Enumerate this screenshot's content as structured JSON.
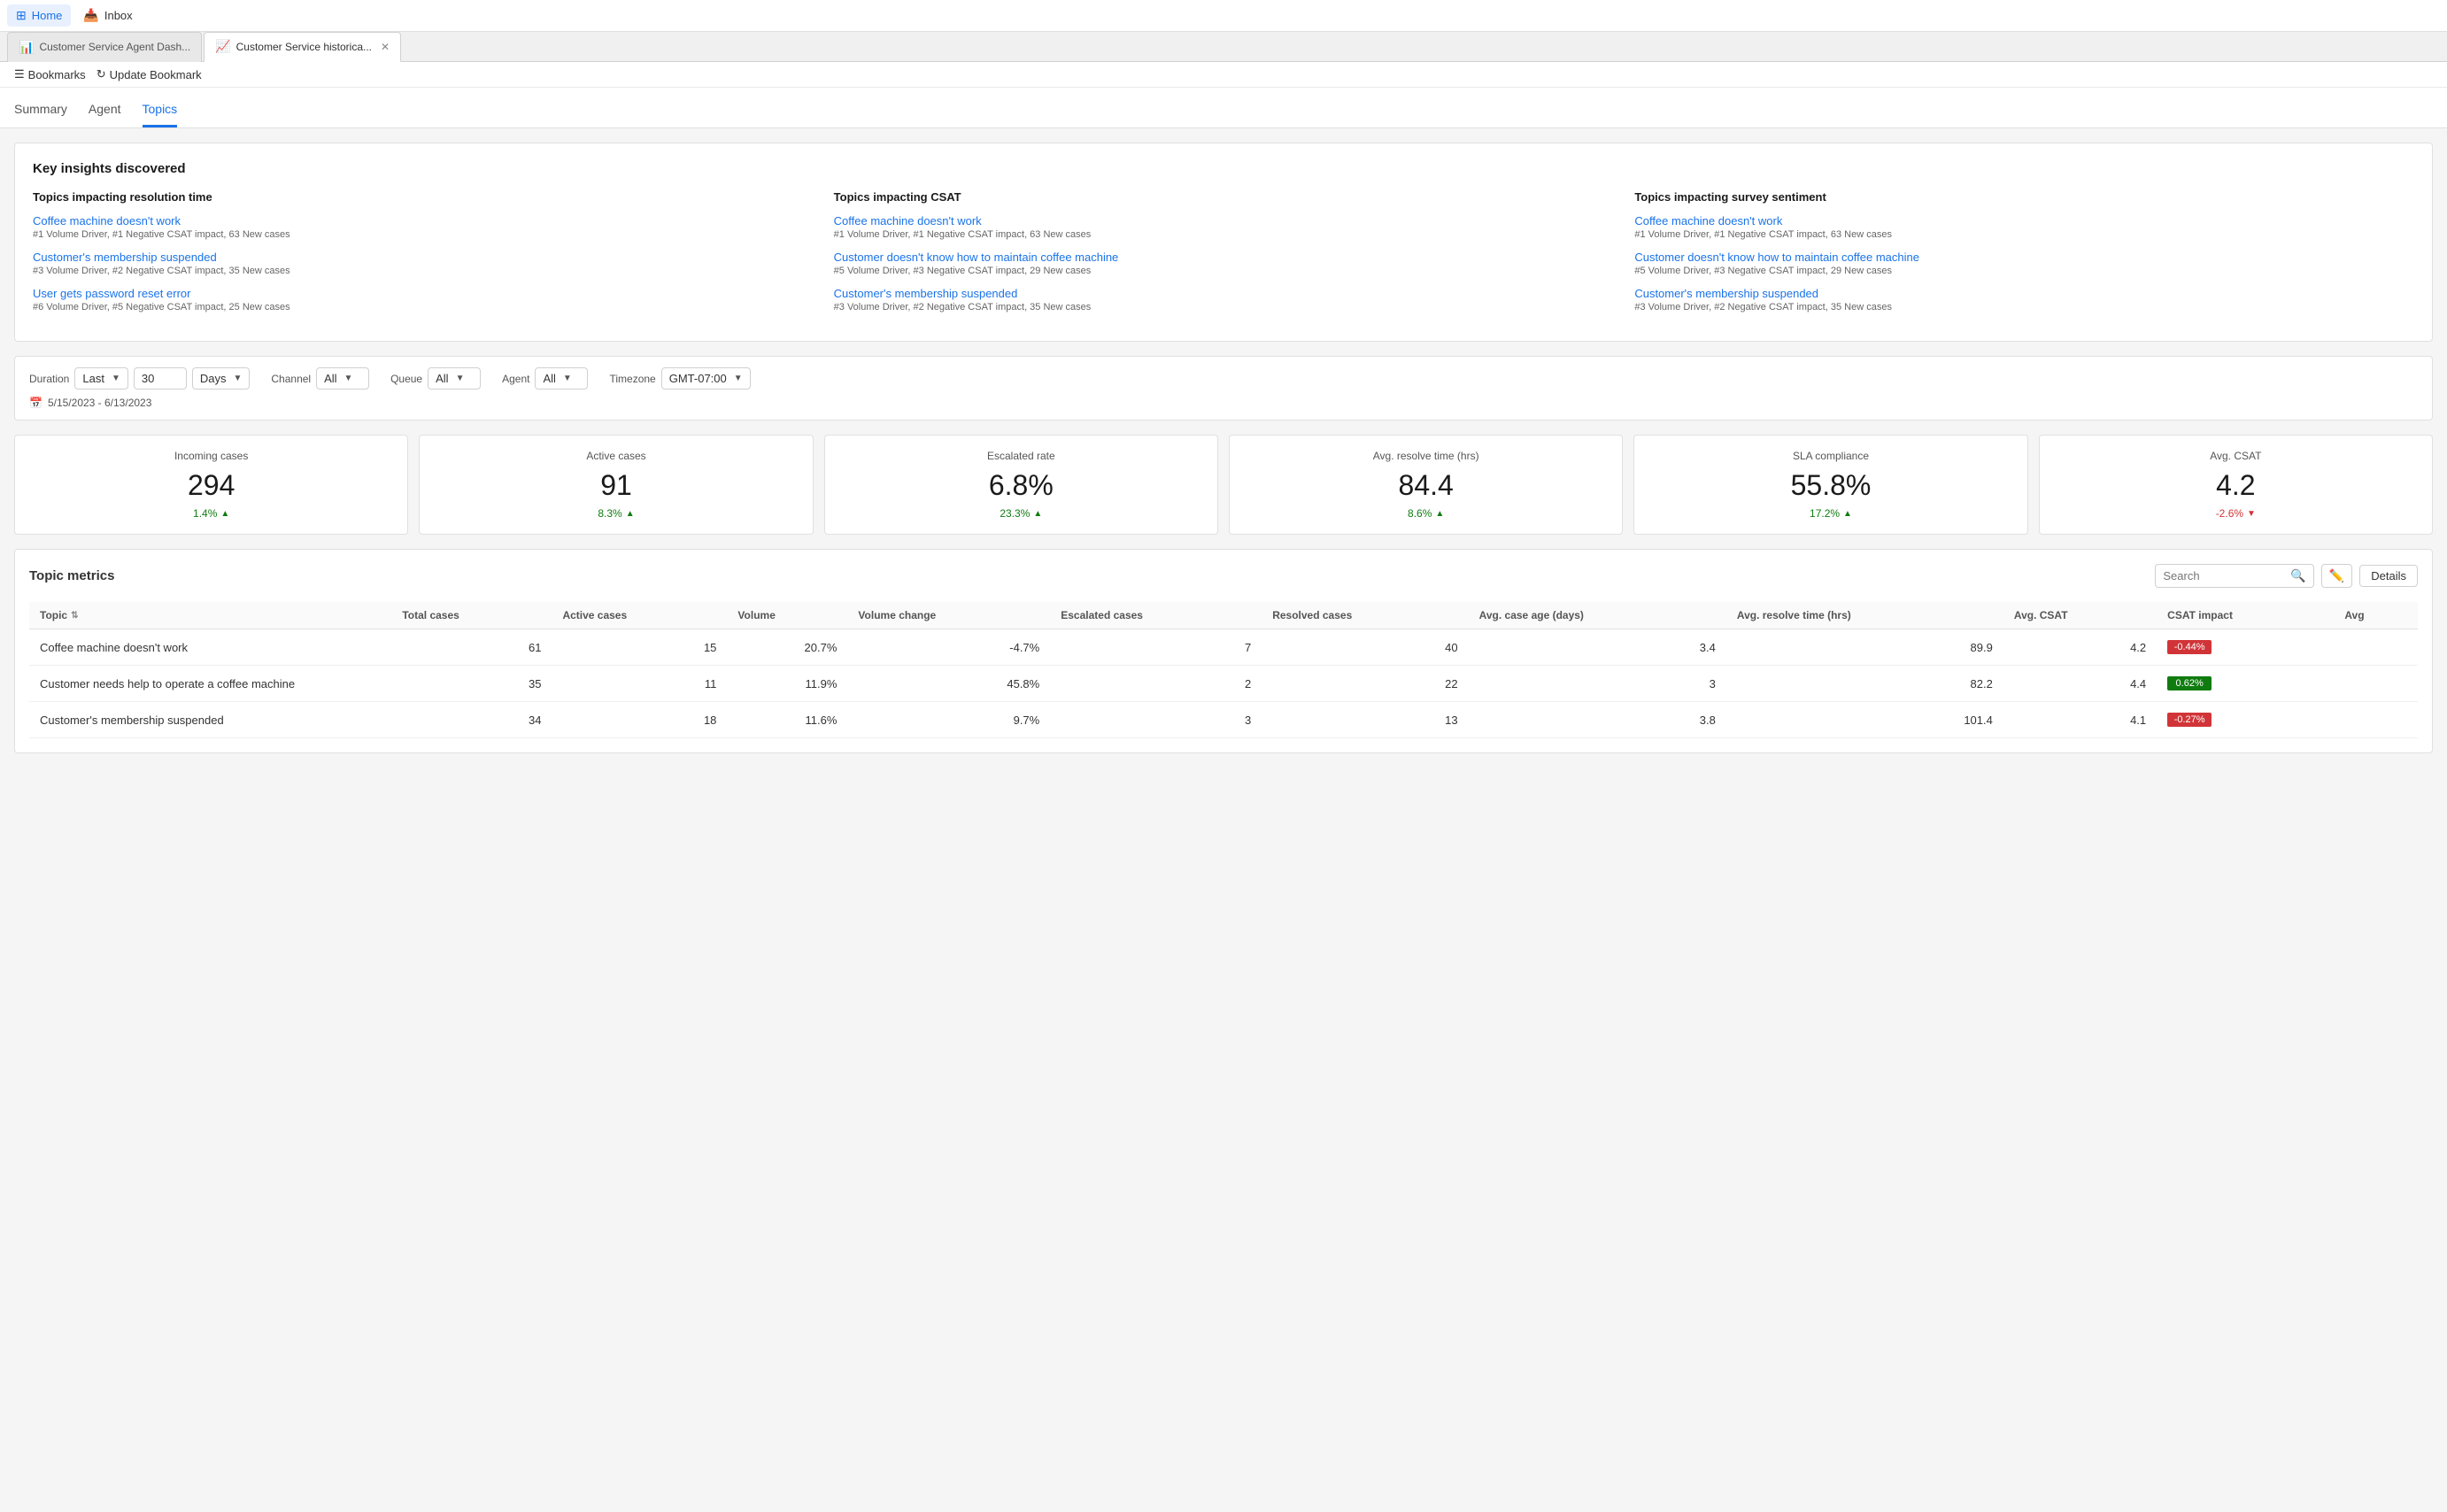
{
  "topBar": {
    "nav": [
      {
        "id": "home",
        "label": "Home",
        "icon": "🏠",
        "active": true
      },
      {
        "id": "inbox",
        "label": "Inbox",
        "icon": "📥",
        "active": false
      }
    ]
  },
  "tabBar": {
    "tabs": [
      {
        "id": "agent-dash",
        "icon": "📊",
        "label": "Customer Service Agent Dash...",
        "closeable": false,
        "active": false
      },
      {
        "id": "historical",
        "icon": "📈",
        "label": "Customer Service historica...",
        "closeable": true,
        "active": true
      }
    ]
  },
  "bookmarkBar": {
    "bookmarksLabel": "Bookmarks",
    "updateLabel": "Update Bookmark"
  },
  "pageTabs": {
    "tabs": [
      {
        "id": "summary",
        "label": "Summary",
        "active": false
      },
      {
        "id": "agent",
        "label": "Agent",
        "active": false
      },
      {
        "id": "topics",
        "label": "Topics",
        "active": true
      }
    ]
  },
  "keyInsights": {
    "title": "Key insights discovered",
    "columns": [
      {
        "title": "Topics impacting resolution time",
        "items": [
          {
            "link": "Coffee machine doesn't work",
            "sub": "#1 Volume Driver, #1 Negative CSAT impact, 63 New cases"
          },
          {
            "link": "Customer's membership suspended",
            "sub": "#3 Volume Driver, #2 Negative CSAT impact, 35 New cases"
          },
          {
            "link": "User gets password reset error",
            "sub": "#6 Volume Driver, #5 Negative CSAT impact, 25 New cases"
          }
        ]
      },
      {
        "title": "Topics impacting CSAT",
        "items": [
          {
            "link": "Coffee machine doesn't work",
            "sub": "#1 Volume Driver, #1 Negative CSAT impact, 63 New cases"
          },
          {
            "link": "Customer doesn't know how to maintain coffee machine",
            "sub": "#5 Volume Driver, #3 Negative CSAT impact, 29 New cases"
          },
          {
            "link": "Customer's membership suspended",
            "sub": "#3 Volume Driver, #2 Negative CSAT impact, 35 New cases"
          }
        ]
      },
      {
        "title": "Topics impacting survey sentiment",
        "items": [
          {
            "link": "Coffee machine doesn't work",
            "sub": "#1 Volume Driver, #1 Negative CSAT impact, 63 New cases"
          },
          {
            "link": "Customer doesn't know how to maintain coffee machine",
            "sub": "#5 Volume Driver, #3 Negative CSAT impact, 29 New cases"
          },
          {
            "link": "Customer's membership suspended",
            "sub": "#3 Volume Driver, #2 Negative CSAT impact, 35 New cases"
          }
        ]
      }
    ]
  },
  "filters": {
    "duration": {
      "label": "Duration",
      "prefix": "Last",
      "value": "30",
      "suffix": "Days"
    },
    "channel": {
      "label": "Channel",
      "value": "All"
    },
    "queue": {
      "label": "Queue",
      "value": "All"
    },
    "agent": {
      "label": "Agent",
      "value": "All"
    },
    "timezone": {
      "label": "Timezone",
      "value": "GMT-07:00"
    },
    "dateRange": "5/15/2023 - 6/13/2023"
  },
  "kpis": [
    {
      "id": "incoming",
      "title": "Incoming cases",
      "value": "294",
      "change": "1.4%",
      "direction": "up"
    },
    {
      "id": "active",
      "title": "Active cases",
      "value": "91",
      "change": "8.3%",
      "direction": "up"
    },
    {
      "id": "escalated",
      "title": "Escalated rate",
      "value": "6.8%",
      "change": "23.3%",
      "direction": "up"
    },
    {
      "id": "resolve-time",
      "title": "Avg. resolve time (hrs)",
      "value": "84.4",
      "change": "8.6%",
      "direction": "up"
    },
    {
      "id": "sla",
      "title": "SLA compliance",
      "value": "55.8%",
      "change": "17.2%",
      "direction": "up"
    },
    {
      "id": "csat",
      "title": "Avg. CSAT",
      "value": "4.2",
      "change": "-2.6%",
      "direction": "down"
    }
  ],
  "topicMetrics": {
    "title": "Topic metrics",
    "searchPlaceholder": "Search",
    "detailsLabel": "Details",
    "columns": [
      "Topic",
      "Total cases",
      "Active cases",
      "Volume",
      "Volume change",
      "Escalated cases",
      "Resolved cases",
      "Avg. case age (days)",
      "Avg. resolve time (hrs)",
      "Avg. CSAT",
      "CSAT impact",
      "Avg"
    ],
    "rows": [
      {
        "topic": "Coffee machine doesn't work",
        "totalCases": 61,
        "activeCases": 15,
        "volume": "20.7%",
        "volumeChange": "-4.7%",
        "escalatedCases": 7,
        "resolvedCases": 40,
        "avgCaseAge": 3.4,
        "avgResolveTime": 89.9,
        "avgCsat": 4.2,
        "csatImpact": "-0.44%",
        "csatColor": "red"
      },
      {
        "topic": "Customer needs help to operate a coffee machine",
        "totalCases": 35,
        "activeCases": 11,
        "volume": "11.9%",
        "volumeChange": "45.8%",
        "escalatedCases": 2,
        "resolvedCases": 22,
        "avgCaseAge": 3.0,
        "avgResolveTime": 82.2,
        "avgCsat": 4.4,
        "csatImpact": "0.62%",
        "csatColor": "green"
      },
      {
        "topic": "Customer's membership suspended",
        "totalCases": 34,
        "activeCases": 18,
        "volume": "11.6%",
        "volumeChange": "9.7%",
        "escalatedCases": 3,
        "resolvedCases": 13,
        "avgCaseAge": 3.8,
        "avgResolveTime": 101.4,
        "avgCsat": 4.1,
        "csatImpact": "-0.27%",
        "csatColor": "red"
      }
    ]
  }
}
